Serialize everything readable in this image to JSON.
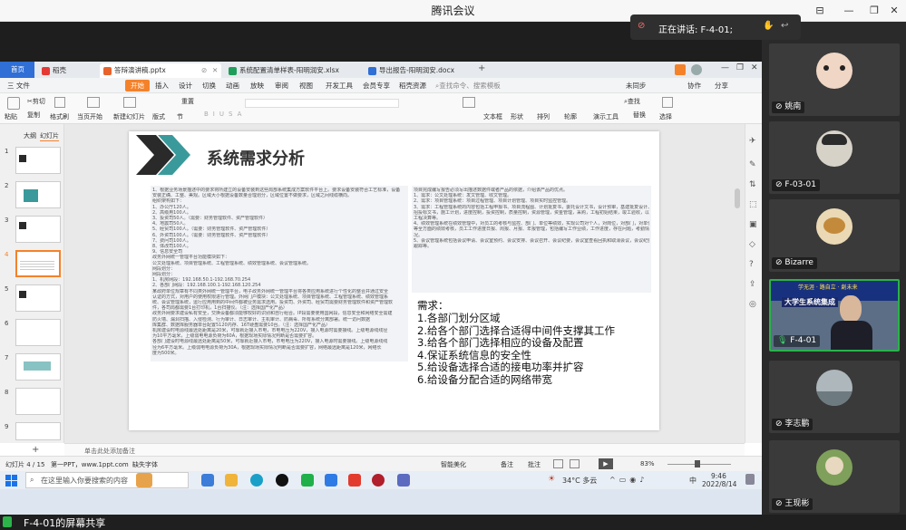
{
  "meeting": {
    "title": "腾讯会议",
    "speaking_label": "正在讲话: F-4-01;",
    "share_label": "F-4-01的屏幕共享"
  },
  "participants": [
    {
      "name": "姚南"
    },
    {
      "name": "F-03-01"
    },
    {
      "name": "Bizarre"
    },
    {
      "name": "F-4-01",
      "overlay_line1": "学无涯 · 路自立 · 創未来",
      "overlay_line2": "大学生系统集成"
    },
    {
      "name": "李志鹏"
    },
    {
      "name": "王现彬"
    }
  ],
  "wps": {
    "tabs": [
      {
        "label": "首页"
      },
      {
        "label": "稻壳"
      },
      {
        "label": "答辩演讲稿.pptx"
      },
      {
        "label": "系统配置清单样表-阳明润安.xlsx"
      },
      {
        "label": "导出报告-阳明润安.docx"
      }
    ],
    "menus": [
      "三 文件",
      "开始",
      "插入",
      "设计",
      "切换",
      "动画",
      "放映",
      "审阅",
      "视图",
      "开发工具",
      "会员专享",
      "稻壳资源"
    ],
    "search_placeholder": "查找命令、搜索模板",
    "menu_right": [
      "未同步",
      "协作",
      "分享"
    ],
    "ribbon": [
      "剪切",
      "复制",
      "格式刷",
      "粘贴",
      "当页开始",
      "新建幻灯片",
      "版式",
      "节",
      "重置",
      "文本框",
      "形状",
      "排列",
      "轮廓",
      "查找",
      "替换",
      "演示工具",
      "选择"
    ],
    "panel_tabs": [
      "大纲",
      "幻灯片"
    ],
    "slide_count": 9,
    "active_slide": 4,
    "slide": {
      "title": "系统需求分析",
      "left_text": [
        "1、根据业务场景描述中的要求将所建立的设备安装到这些局部系统集成方案软件平台上。要求设备安装符合工艺标准，设备",
        "安装正确、工整、美观。区域大小根据设备数量合理划分，区域位置不做要求，区域之间线缆横向。",
        "组织架构如下：",
        "1、办公厅120人。",
        "2、高级用100人。",
        "3、投资司50人。（需要：财务管理软件、资产管理软件）",
        "4、地震司50人。",
        "5、经贸司100人。（需要：财务管理软件、资产管理软件）",
        "6、外资司100人。（需要：财务管理软件、资产管理软件）",
        "7、费问司100人。",
        "8、体改司100人。",
        "9、信息安全司",
        "政务外网统一管理平台功能模块如下：",
        "公文处理系统、项目管理系统、工程管理系统、绩效管理系统、会议管理系统。",
        "网段划分：",
        "",
        "网段划分：",
        "1、机房网段：192.168.50.1-192.168.70.254",
        "2、各部门网段：192.168.100.1-192.168.120.254",
        "某政府单位规章有不同类外网统一管理平台，电子政务外网统一管理平台将各类应用系统进行个性化的整合并通过安全",
        "认证的方式，对用户的使用权限进行管理。外网门户模块：公文处理系统、项目管理系统、工程管理系统、绩效管理系",
        "统、会议管理系统，运行应用用到的中间件都被业务需求选用。投资司、外资司、经贸司需要财务管理软件和资产管理软",
        "件，各司局都需要1台打印机，1台扫描仪。（注：选择国产化产品）",
        "政务外网要求建设私有安全，交换设备都须能够较好的识别和自行组合。IP段需要使用国网段，信息安全和网络安全需建",
        "防火墙、漏洞扫描、入侵检测、行为审计、日志审计、主机审计、防病毒、所有系统分离部署。统一访问数据",
        "库集群、数据库服务器单台配置5120内存、16T硬盘需要10台。（注：选择国产化产品）",
        "机房建设时电源线最远处距离是20米，可靠就近接入市电，市电电压为220V，接入电源时需要接线。上级电源线线径",
        "为10平方毫米，上级弱电电源负荷为60A，根据现场实际情况判断是否需要扩容。",
        "各部门建设时电源线最远处距离是50米，可靠就近接入市电，市电电压为220V，接入电源时需要接线。上级电源线线",
        "径为6平方毫米。上级弱电电源负荷为30A，根据现场实际情况判断是否需要扩容，网络最远距离是120米，网络长",
        "度为500米。"
      ],
      "right_text": [
        "项目完成编写报告必须写出描述数据件或者产品的依据，介绍该产品的优点。",
        "1、需求：公文处理系统：发文管理、收文管理。",
        "2、需求：项目管理系统：项目过程管理、项目计划管理、项目实时监控管理。",
        "3、需求：工程管理系统的内容包括工程申报书、项目流程图、计划批复书，委托设计文书，设计预审，基建批复设计、",
        "招投标文书，施工计划，进度控制，投资控制，质量控制，资源管理，资金管理，采购，工程初始结果，竣工验收，以及",
        "工程决算等。",
        "4、绩效管理系统在绩效管理中，对员工的考核与监控、部门、单位等绩效，实现公司对个人，对岗位，对部门，对单位",
        "等全方面的绩效考核，员工工作进度日报、周报、月报、年报管理，包括编写工作业绩，工作进度，存在问题，考勤情",
        "况。",
        "5、会议管理系统包括会议申请、会议室预约、会议安排、会议召开、会议纪要，会议室查看回执和取消会议，会议纪要，会议公告，会议",
        "跟踪等。"
      ],
      "needs_title": "需求：",
      "needs": [
        "1.各部门划分区域",
        "2.给各个部门选择合适得中间件支撑其工作",
        "3.给各个部门选择相应的设备及配置",
        "4.保证系统信息的安全性",
        "5.给设备选择合适的接电功率并扩容",
        "6.给设备分配合适的网络带宽"
      ]
    },
    "notes_placeholder": "单击此处添加备注",
    "status": {
      "slide_info": "幻灯片 4 / 15",
      "theme": "第一PPT，www.1ppt.com",
      "font_missing": "缺失字体",
      "beautify": "智能美化",
      "notes": "备注",
      "comment": "批注",
      "zoom": "83%"
    }
  },
  "taskbar": {
    "search_placeholder": "在这里输入你要搜索的内容",
    "weather": "34°C 多云",
    "ime": "中",
    "time": "9:46",
    "date": "2022/8/14"
  },
  "colors": {
    "accent_orange": "#f4822a",
    "teal": "#3a9a9b",
    "dark": "#2a2a2a"
  }
}
